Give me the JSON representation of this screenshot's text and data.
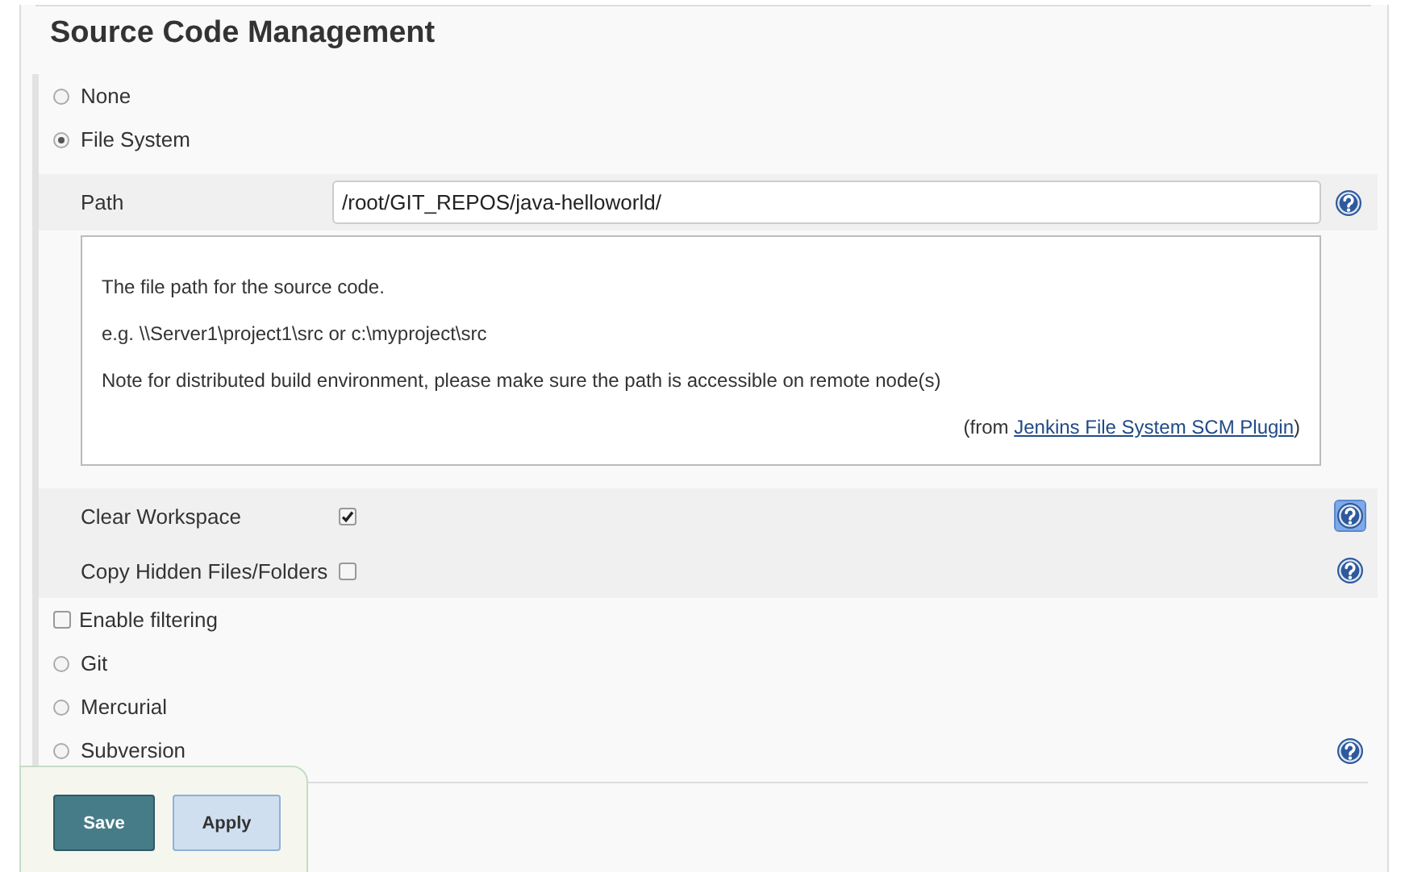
{
  "section": {
    "title": "Source Code Management"
  },
  "options": [
    {
      "kind": "radio",
      "label": "None",
      "selected": false
    },
    {
      "kind": "radio",
      "label": "File System",
      "selected": true,
      "config": {
        "path": {
          "label": "Path",
          "value": "/root/GIT_REPOS/java-helloworld/"
        },
        "help": {
          "lines": [
            "The file path for the source code.",
            "e.g. \\\\Server1\\project1\\src or c:\\myproject\\src",
            "Note for distributed build environment, please make sure the path is accessible on remote node(s)"
          ],
          "source_prefix": "(from",
          "source_link": "Jenkins File System SCM Plugin",
          "source_suffix": ")"
        },
        "checkboxes": [
          {
            "label": "Clear Workspace",
            "checked": true,
            "help_focused": true
          },
          {
            "label": "Copy Hidden Files/Folders",
            "checked": false,
            "help_focused": false
          }
        ]
      }
    },
    {
      "kind": "checkbox",
      "label": "Enable filtering",
      "checked": false
    },
    {
      "kind": "radio",
      "label": "Git",
      "selected": false
    },
    {
      "kind": "radio",
      "label": "Mercurial",
      "selected": false
    },
    {
      "kind": "radio",
      "label": "Subversion",
      "selected": false,
      "help": true
    }
  ],
  "buttons": [
    {
      "label": "Save",
      "kind": "primary"
    },
    {
      "label": "Apply",
      "kind": "secondary"
    }
  ]
}
